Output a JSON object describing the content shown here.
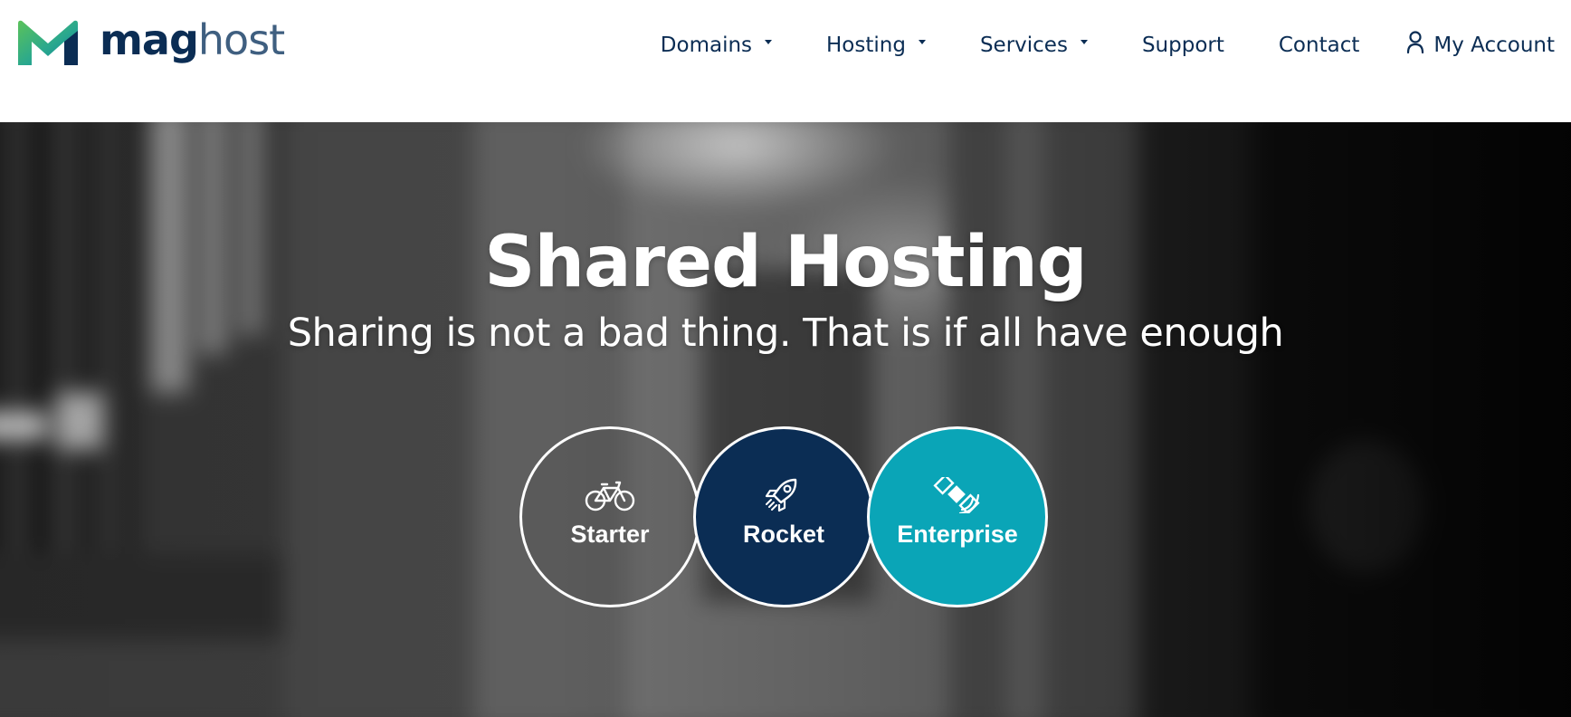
{
  "brand": {
    "name_part1": "mag",
    "name_part2": "host",
    "colors": {
      "navy": "#0b2d54",
      "slate": "#3f5f80",
      "green": "#5bc25a",
      "teal": "#0aa5b7"
    }
  },
  "nav": {
    "items": [
      {
        "label": "Domains",
        "dropdown": true
      },
      {
        "label": "Hosting",
        "dropdown": true
      },
      {
        "label": "Services",
        "dropdown": true
      },
      {
        "label": "Support",
        "dropdown": false
      },
      {
        "label": "Contact",
        "dropdown": false
      }
    ],
    "account": {
      "label": "My Account",
      "icon": "user-icon"
    }
  },
  "hero": {
    "title": "Shared Hosting",
    "subtitle": "Sharing is not a bad thing. That is if all have enough"
  },
  "plans": [
    {
      "label": "Starter",
      "icon": "bicycle-icon",
      "color": "transparent"
    },
    {
      "label": "Rocket",
      "icon": "rocket-icon",
      "color": "#0b2d54"
    },
    {
      "label": "Enterprise",
      "icon": "satellite-icon",
      "color": "#0aa5b7"
    }
  ]
}
